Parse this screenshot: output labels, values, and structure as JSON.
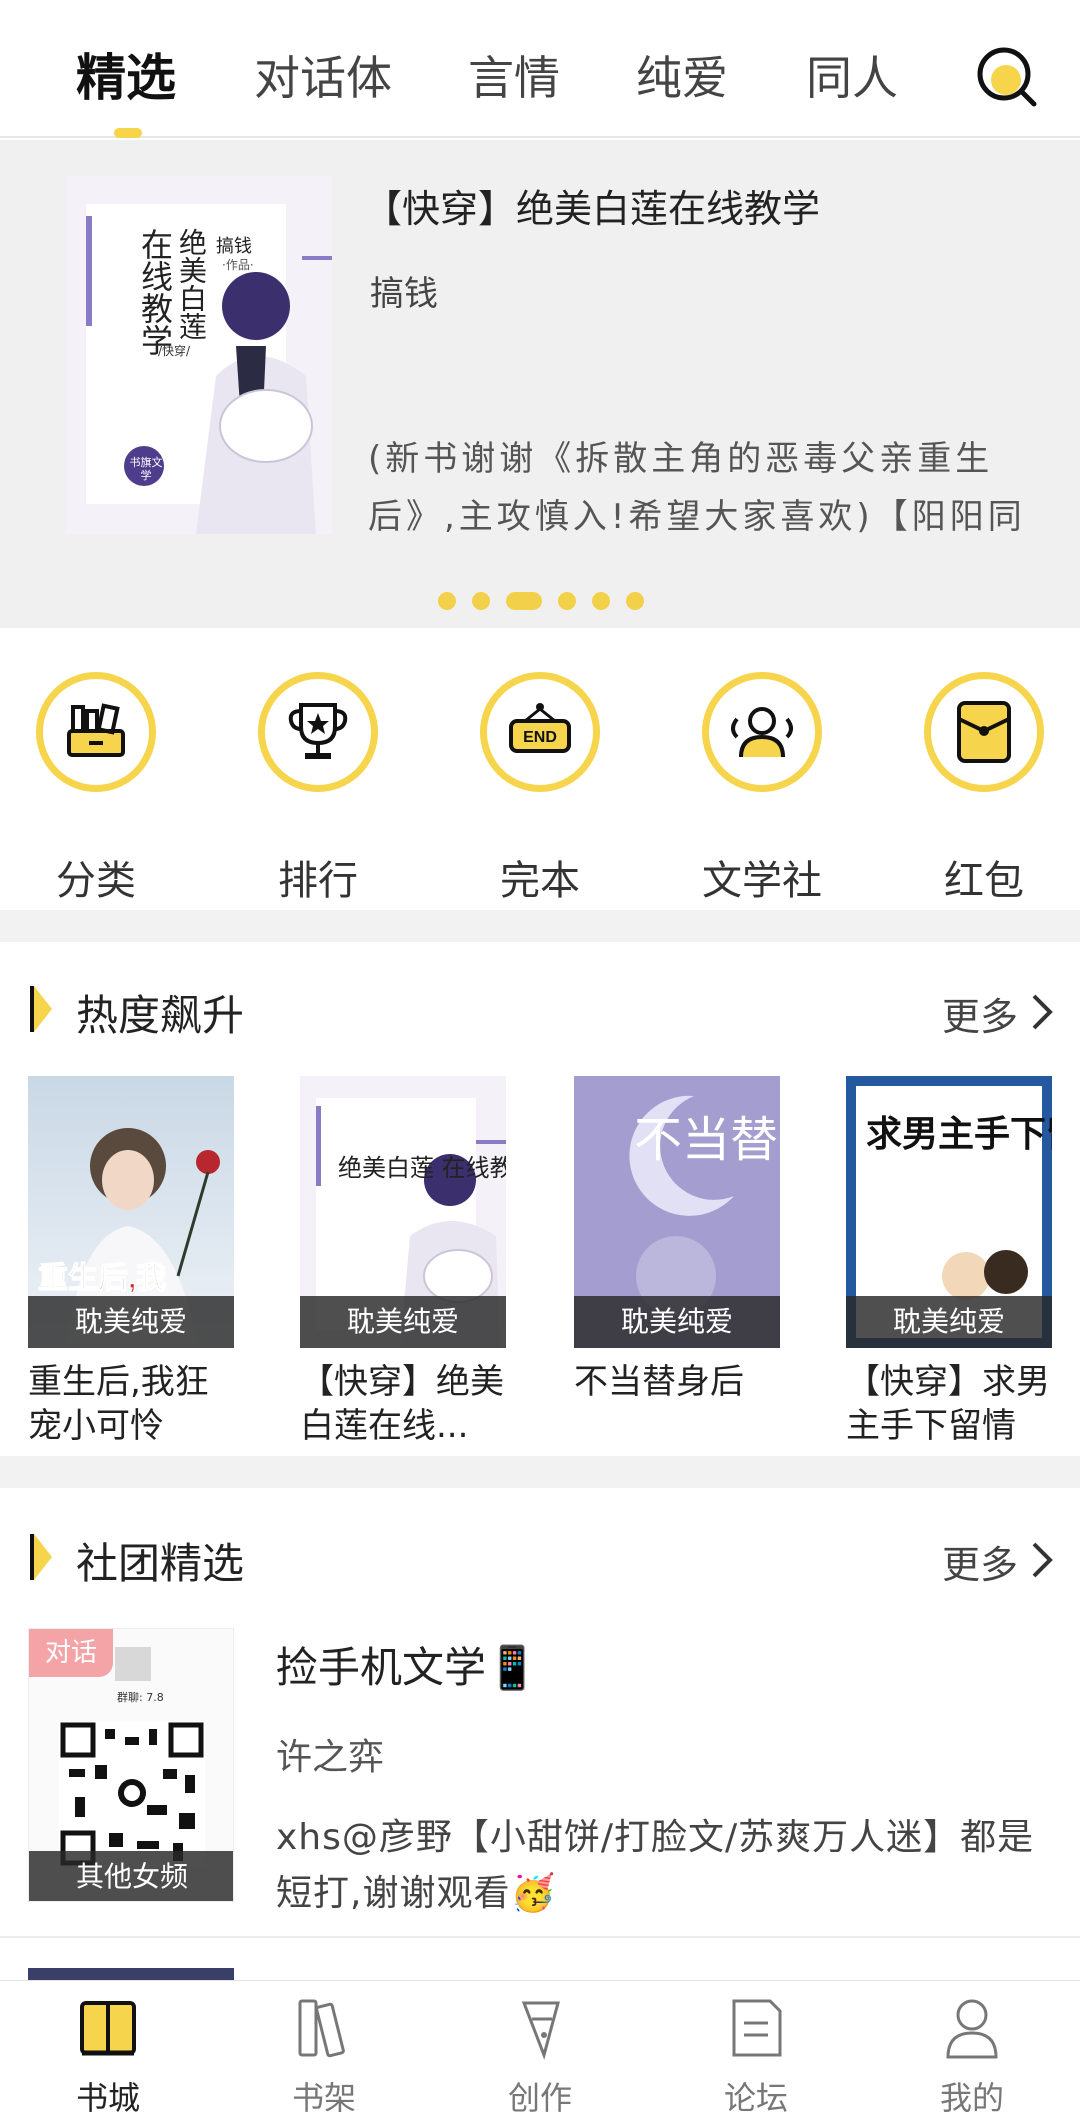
{
  "top_tabs": [
    {
      "label": "精选",
      "active": true
    },
    {
      "label": "对话体",
      "active": false
    },
    {
      "label": "言情",
      "active": false
    },
    {
      "label": "纯爱",
      "active": false
    },
    {
      "label": "同人",
      "active": false
    }
  ],
  "banner": {
    "cover": {
      "title_lines": [
        "绝美白莲",
        "在线教学"
      ],
      "author": "搞钱",
      "author_sub": "·作品·",
      "genre": "/快穿/",
      "publisher": "书旗文学"
    },
    "title": "【快穿】绝美白莲在线教学",
    "author": "搞钱",
    "description": "(新书谢谢《拆散主角的恶毒父亲重生后》,主攻慎入!希望大家喜欢)【阳阳同",
    "dots_total": 6,
    "dots_active": 2
  },
  "quick_links": [
    {
      "label": "分类",
      "icon": "category-icon"
    },
    {
      "label": "排行",
      "icon": "trophy-icon"
    },
    {
      "label": "完本",
      "icon": "end-sign-icon",
      "icon_text": "END"
    },
    {
      "label": "文学社",
      "icon": "community-icon"
    },
    {
      "label": "红包",
      "icon": "red-envelope-icon"
    }
  ],
  "hot_section": {
    "title": "热度飙升",
    "more": "更多",
    "books": [
      {
        "name": "重生后,我狂宠小可怜",
        "tag": "耽美纯爱",
        "cover_text": "重生后,我"
      },
      {
        "name": "【快穿】绝美白莲在线...",
        "tag": "耽美纯爱",
        "cover_text": "绝美白莲 在线教学"
      },
      {
        "name": "不当替身后",
        "tag": "耽美纯爱",
        "cover_text": "不当替身"
      },
      {
        "name": "【快穿】求男主手下留情",
        "tag": "耽美纯爱",
        "cover_text": "求男主手下留情"
      }
    ]
  },
  "club_section": {
    "title": "社团精选",
    "more": "更多",
    "item": {
      "badge": "对话",
      "tag": "其他女频",
      "group_text": "群聊: 7.8",
      "title": "捡手机文学📱",
      "author": "许之弈",
      "description": "xhs@彦野【小甜饼/打脸文/苏爽万人迷】都是短打,谢谢观看🥳"
    }
  },
  "bottom_nav": [
    {
      "label": "书城",
      "icon": "book-city-icon",
      "active": true
    },
    {
      "label": "书架",
      "icon": "bookshelf-icon",
      "active": false
    },
    {
      "label": "创作",
      "icon": "pen-icon",
      "active": false
    },
    {
      "label": "论坛",
      "icon": "forum-icon",
      "active": false
    },
    {
      "label": "我的",
      "icon": "profile-icon",
      "active": false
    }
  ],
  "colors": {
    "accent": "#f6d44c",
    "tag_bg": "#333333",
    "badge": "#f4a4a6"
  }
}
